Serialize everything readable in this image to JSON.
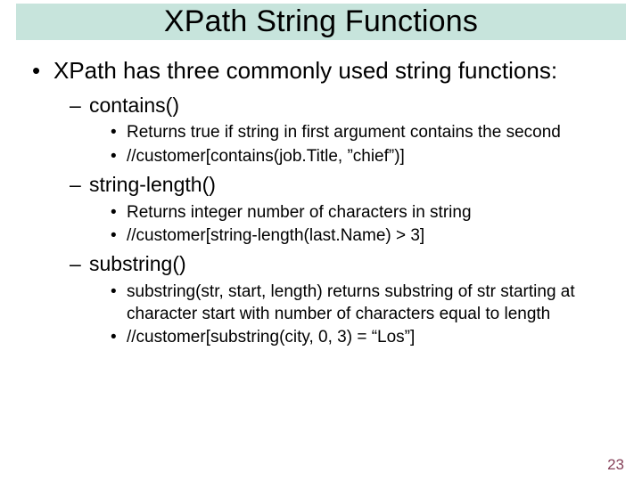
{
  "title": "XPath String Functions",
  "bullets": {
    "main": "XPath has three commonly used string functions:",
    "funcs": [
      {
        "name": "contains()",
        "pts": [
          "Returns true if string in first argument contains the second",
          "//customer[contains(job.Title, ”chief”)]"
        ]
      },
      {
        "name": "string-length()",
        "pts": [
          "Returns integer number of characters in string",
          "//customer[string-length(last.Name) > 3]"
        ]
      },
      {
        "name": "substring()",
        "pts": [
          "substring(str, start, length) returns substring of str starting at character start with number of characters equal to length",
          "//customer[substring(city, 0, 3) = “Los”]"
        ]
      }
    ]
  },
  "slide_number": "23"
}
